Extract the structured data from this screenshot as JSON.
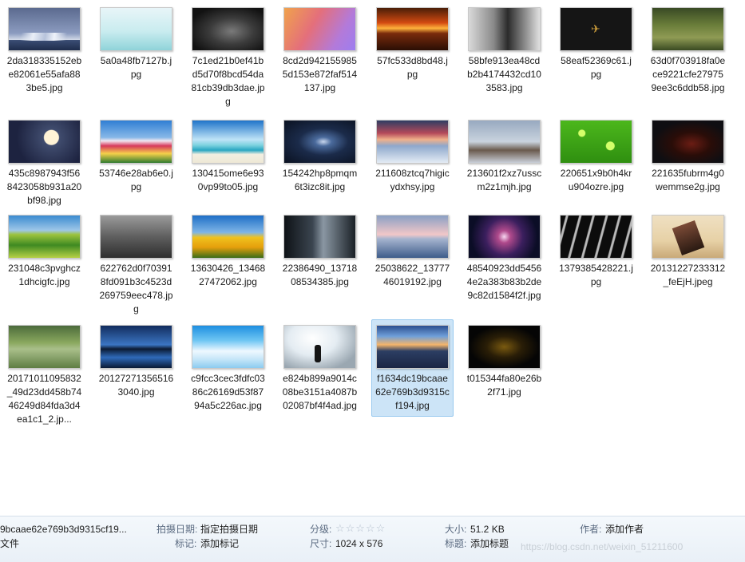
{
  "files": [
    {
      "name": "2da318335152ebe82061e55afa883be5.jpg",
      "art": "t-mount"
    },
    {
      "name": "5a0a48fb7127b.jpg",
      "art": "t-bird"
    },
    {
      "name": "7c1ed21b0ef41bd5d70f8bcd54da81cb39db3dae.jpg",
      "art": "t-car"
    },
    {
      "name": "8cd2d9421559855d153e872faf514137.jpg",
      "art": "t-pastel"
    },
    {
      "name": "57fc533d8bd48.jpg",
      "art": "t-sunset"
    },
    {
      "name": "58bfe913ea48cdb2b4174432cd103583.jpg",
      "art": "t-person"
    },
    {
      "name": "58eaf52369c61.jpg",
      "art": "t-dark"
    },
    {
      "name": "63d0f703918fa0ece9221cfe279759ee3c6ddb58.jpg",
      "art": "t-forest"
    },
    {
      "name": "435c8987943f568423058b931a20bf98.jpg",
      "art": "t-lanterns"
    },
    {
      "name": "53746e28ab6e0.jpg",
      "art": "t-tulips"
    },
    {
      "name": "130415ome6e930vp99to05.jpg",
      "art": "t-beach"
    },
    {
      "name": "154242hp8pmqm6t3izc8it.jpg",
      "art": "t-galaxy"
    },
    {
      "name": "211608ztcq7higicydxhsy.jpg",
      "art": "t-snow"
    },
    {
      "name": "213601f2xz7usscm2z1mjh.jpg",
      "art": "t-owl"
    },
    {
      "name": "220651x9b0h4kru904ozre.jpg",
      "art": "t-drops"
    },
    {
      "name": "221635fubrm4g0wemmse2g.jpg",
      "art": "t-iron"
    },
    {
      "name": "231048c3pvghcz1dhcigfc.jpg",
      "art": "t-hills"
    },
    {
      "name": "622762d0f703918fd091b3c4523d269759eec478.jpg",
      "art": "t-flower"
    },
    {
      "name": "13630426_1346827472062.jpg",
      "art": "t-sunflower"
    },
    {
      "name": "22386490_1371808534385.jpg",
      "art": "t-man"
    },
    {
      "name": "25038622_1377746019192.jpg",
      "art": "t-bridge"
    },
    {
      "name": "48540923dd54564e2a383b83b2de9c82d1584f2f.jpg",
      "art": "t-spiral"
    },
    {
      "name": "1379385428221.jpg",
      "art": "t-lines"
    },
    {
      "name": "20131227233312_feEjH.jpeg",
      "art": "t-paper"
    },
    {
      "name": "20171011095832_49d23dd458b7446249d84fda3d4ea1c1_2.jp...",
      "art": "t-pond"
    },
    {
      "name": "201272713565163040.jpg",
      "art": "t-lake"
    },
    {
      "name": "c9fcc3cec3fdfc0386c26169d53f8794a5c226ac.jpg",
      "art": "t-clouds"
    },
    {
      "name": "e824b899a9014c08be3151a4087b02087bf4f4ad.jpg",
      "art": "t-bright"
    },
    {
      "name": "f1634dc19bcaae62e769b3d9315cf194.jpg",
      "art": "t-mist",
      "selected": true
    },
    {
      "name": "t015344fa80e26b2f71.jpg",
      "art": "t-kobe"
    }
  ],
  "status_bar": {
    "filename": "9bcaae62e769b3d9315cf19...",
    "type_label": "文件",
    "date_label": "拍摄日期:",
    "date_value": "指定拍摄日期",
    "tags_label": "标记:",
    "tags_value": "添加标记",
    "rating_label": "分级:",
    "rating_stars": "☆☆☆☆☆",
    "dims_label": "尺寸:",
    "dims_value": "1024 x 576",
    "size_label": "大小:",
    "size_value": "51.2 KB",
    "title_label": "标题:",
    "title_value": "添加标题",
    "author_label": "作者:",
    "author_value": "添加作者",
    "watermark": "https://blog.csdn.net/weixin_51211600"
  }
}
